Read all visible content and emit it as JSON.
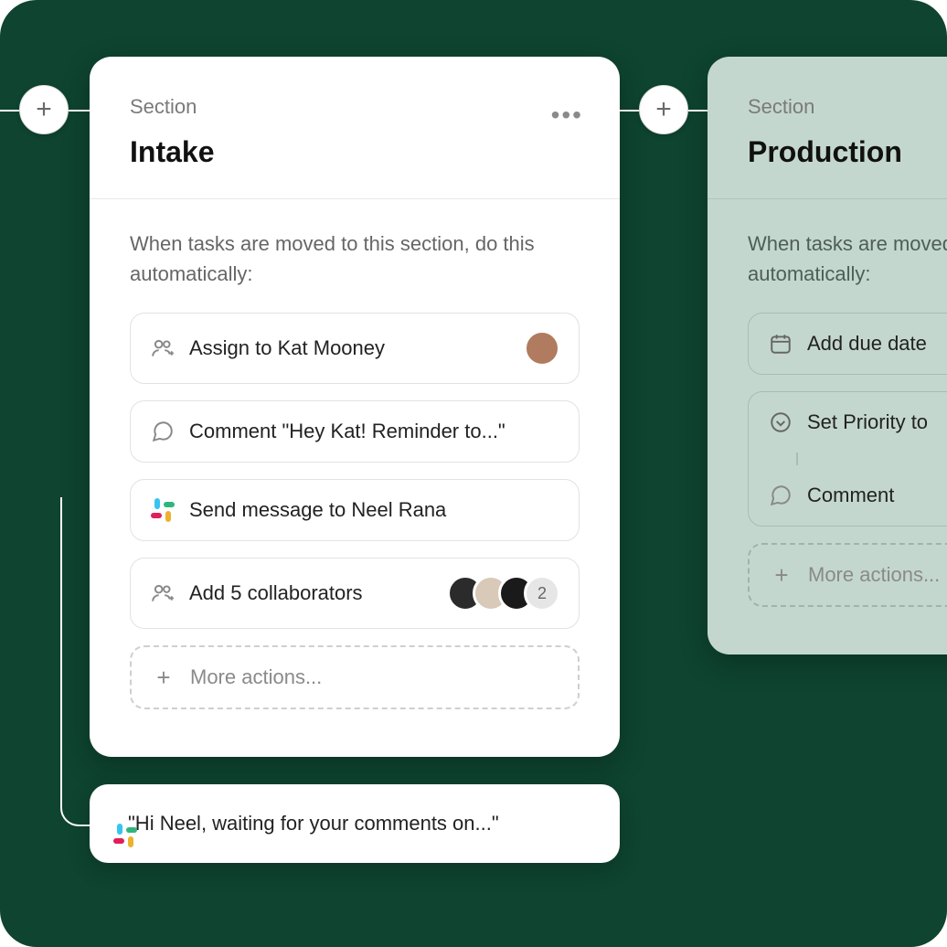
{
  "labels": {
    "section": "Section",
    "rule_intro": "When tasks are moved to this section, do this automatically:",
    "more_actions": "More actions..."
  },
  "intake": {
    "title": "Intake",
    "rules": {
      "assign": "Assign to Kat Mooney",
      "comment": "Comment \"Hey Kat! Reminder to...\"",
      "slack": "Send message to Neel Rana",
      "collab": "Add 5 collaborators",
      "collab_overflow": "2"
    }
  },
  "production": {
    "title": "Production",
    "rules": {
      "due": "Add due date",
      "priority": "Set Priority to",
      "comment": "Comment"
    }
  },
  "slack_popup": {
    "text": "\"Hi Neel, waiting for your comments on...\""
  },
  "avatar_colors": {
    "kat": "#b07b5e",
    "c1": "#2b2b2b",
    "c2": "#d8c9b8",
    "c3": "#1a1a1a"
  }
}
